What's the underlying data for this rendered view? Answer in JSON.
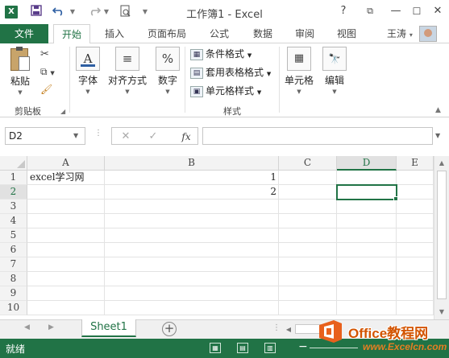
{
  "window": {
    "title": "工作簿1 - Excel",
    "app_icon": "X",
    "help_label": "?",
    "ribbon_display_label": "⧉",
    "minimize_label": "—",
    "maximize_label": "☐",
    "close_label": "✕"
  },
  "qat": {
    "save_icon": "save-icon",
    "undo_icon": "undo-icon",
    "redo_icon": "redo-icon",
    "preview_icon": "print-preview-icon"
  },
  "ribbon_tabs": {
    "file": "文件",
    "home": "开始",
    "insert": "插入",
    "layout": "页面布局",
    "formulas": "公式",
    "data": "数据",
    "review": "审阅",
    "view": "视图"
  },
  "user": {
    "name": "王涛"
  },
  "ribbon": {
    "clipboard": {
      "paste": "粘贴",
      "group_label": "剪贴板"
    },
    "font": {
      "label": "字体"
    },
    "alignment": {
      "label": "对齐方式"
    },
    "number": {
      "label": "数字"
    },
    "styles": {
      "conditional": "条件格式",
      "table": "套用表格格式",
      "cell_styles": "单元格样式",
      "group_label": "样式"
    },
    "cells": {
      "label": "单元格"
    },
    "editing": {
      "label": "编辑"
    }
  },
  "formula_bar": {
    "name_box": "D2",
    "cancel": "✕",
    "enter": "✓",
    "fx": "fx",
    "value": ""
  },
  "sheet": {
    "columns": [
      "A",
      "B",
      "C",
      "D",
      "E"
    ],
    "selected_column": "D",
    "rows": [
      "1",
      "2",
      "3",
      "4",
      "5",
      "6",
      "7",
      "8",
      "9",
      "10"
    ],
    "selected_row": "2",
    "cells": {
      "A1": "excel学习网",
      "B1": "1",
      "B2": "2"
    },
    "active_cell": "D2"
  },
  "sheet_tabs": {
    "active": "Sheet1",
    "add_label": "+"
  },
  "status": {
    "text": "就绪",
    "zoom_minus": "−",
    "accent": "#217346"
  },
  "watermark": {
    "top": "Office教程网",
    "bottom": "www.Excelcn.com"
  }
}
